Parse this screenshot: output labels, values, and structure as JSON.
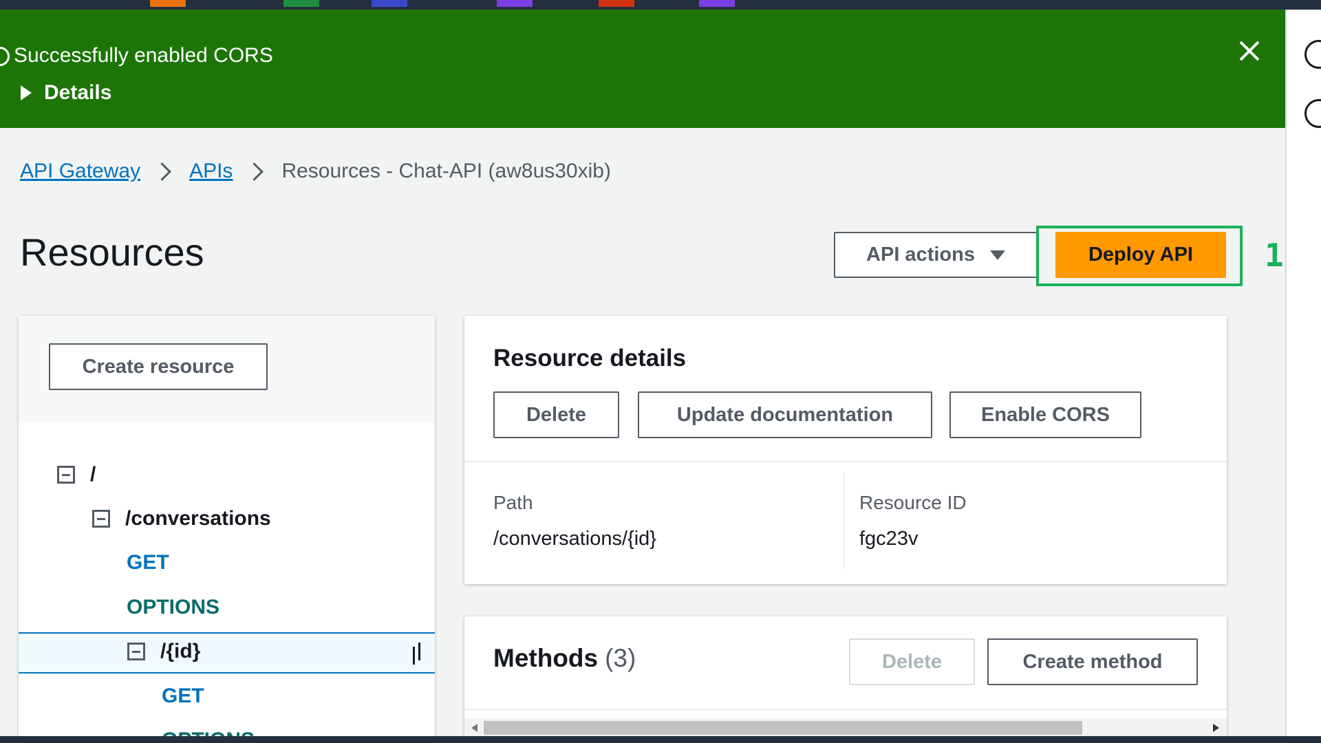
{
  "flash": {
    "message": "Successfully enabled CORS",
    "details_label": "Details",
    "color": "#1d7407"
  },
  "breadcrumb": {
    "items": [
      "API Gateway",
      "APIs"
    ],
    "current": "Resources - Chat-API (aw8us30xib)"
  },
  "page": {
    "title": "Resources"
  },
  "actions": {
    "api_actions_label": "API actions",
    "deploy_label": "Deploy API",
    "step_number": "1"
  },
  "tree": {
    "create_resource_label": "Create resource",
    "items": [
      {
        "label": "/",
        "kind": "resource"
      },
      {
        "label": "/conversations",
        "kind": "resource"
      },
      {
        "label": "GET",
        "kind": "method"
      },
      {
        "label": "OPTIONS",
        "kind": "method"
      },
      {
        "label": "/{id}",
        "kind": "resource",
        "selected": true
      },
      {
        "label": "GET",
        "kind": "method"
      },
      {
        "label": "OPTIONS",
        "kind": "method"
      }
    ]
  },
  "details": {
    "title": "Resource details",
    "delete_label": "Delete",
    "update_doc_label": "Update documentation",
    "enable_cors_label": "Enable CORS",
    "path_key": "Path",
    "path_value": "/conversations/{id}",
    "id_key": "Resource ID",
    "id_value": "fgc23v"
  },
  "methods": {
    "title": "Methods",
    "count": "(3)",
    "delete_label": "Delete",
    "create_label": "Create method"
  },
  "colors": {
    "accent_orange": "#ff9900",
    "link_blue": "#0073bb",
    "highlight_green": "#19b25a"
  }
}
